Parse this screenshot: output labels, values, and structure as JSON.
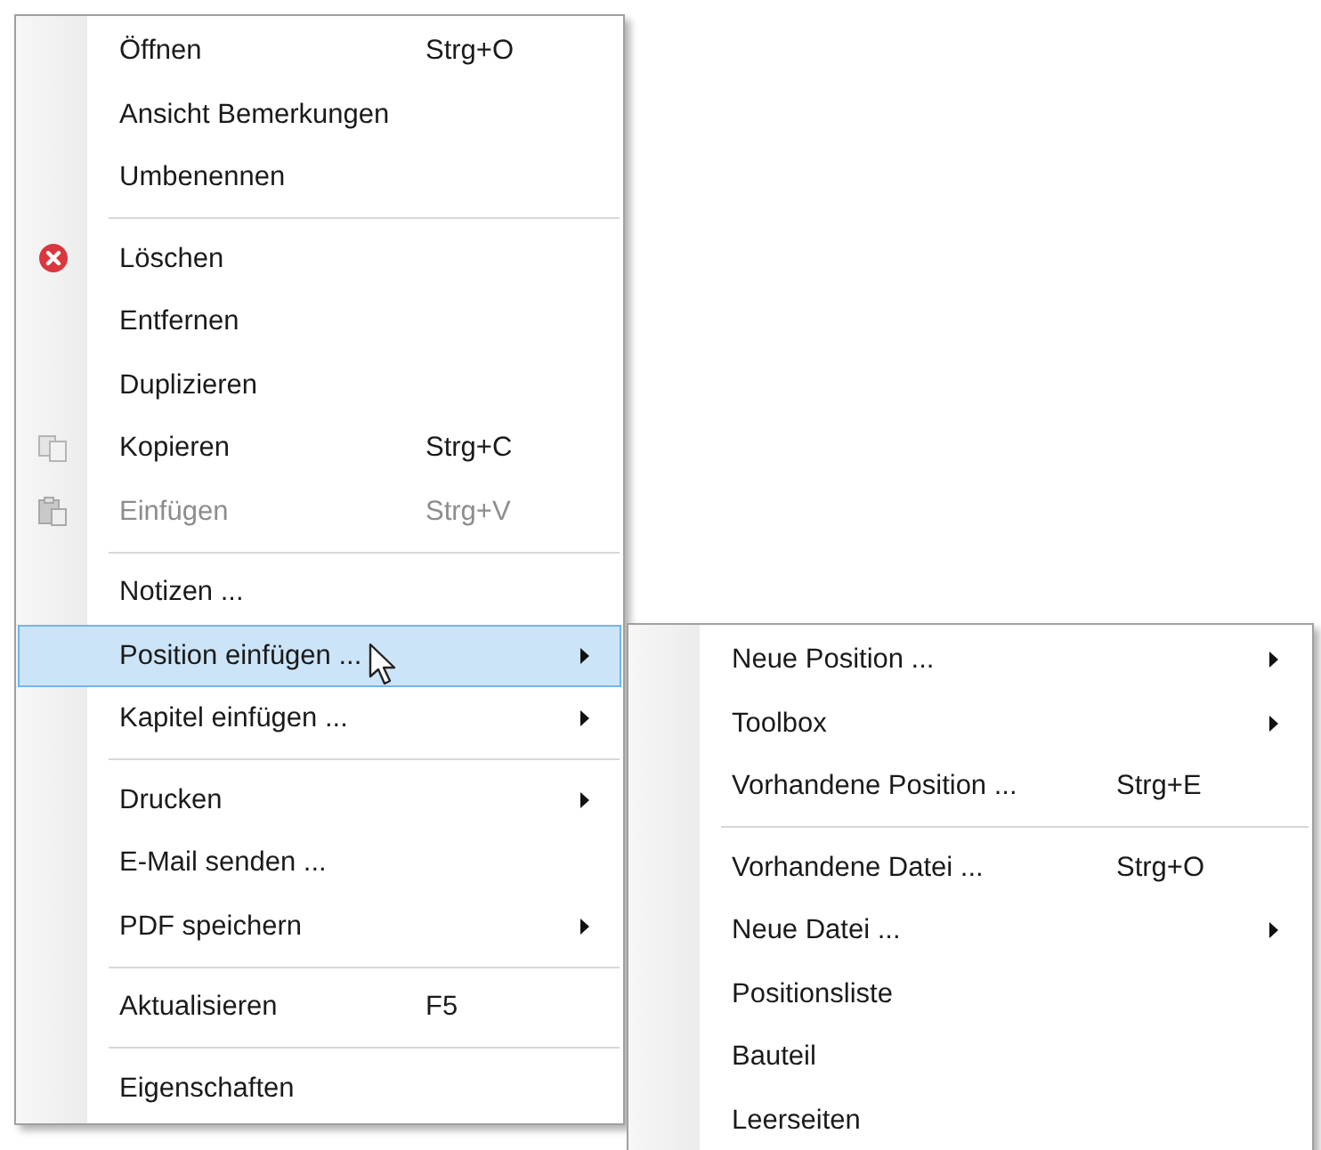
{
  "context_menu": {
    "items": [
      {
        "kind": "item",
        "label": "Öffnen",
        "shortcut": "Strg+O",
        "submenu": false,
        "disabled": false,
        "selected": false
      },
      {
        "kind": "item",
        "label": "Ansicht Bemerkungen",
        "submenu": false,
        "disabled": false,
        "selected": false
      },
      {
        "kind": "item",
        "label": "Umbenennen",
        "submenu": false,
        "disabled": false,
        "selected": false
      },
      {
        "kind": "separator"
      },
      {
        "kind": "delete",
        "label": "Löschen",
        "submenu": false,
        "disabled": false,
        "selected": false
      },
      {
        "kind": "item",
        "label": "Entfernen",
        "submenu": false,
        "disabled": false,
        "selected": false
      },
      {
        "kind": "item",
        "label": "Duplizieren",
        "submenu": false,
        "disabled": false,
        "selected": false
      },
      {
        "kind": "copy",
        "label": "Kopieren",
        "shortcut": "Strg+C",
        "submenu": false,
        "disabled": false,
        "selected": false
      },
      {
        "kind": "paste",
        "label": "Einfügen",
        "shortcut": "Strg+V",
        "submenu": false,
        "disabled": true,
        "selected": false
      },
      {
        "kind": "separator"
      },
      {
        "kind": "item",
        "label": "Notizen ...",
        "submenu": false,
        "disabled": false,
        "selected": false
      },
      {
        "kind": "item",
        "label": "Position einfügen ...",
        "submenu": true,
        "disabled": false,
        "selected": true
      },
      {
        "kind": "item",
        "label": "Kapitel einfügen ...",
        "submenu": true,
        "disabled": false,
        "selected": false
      },
      {
        "kind": "separator"
      },
      {
        "kind": "item",
        "label": "Drucken",
        "submenu": true,
        "disabled": false,
        "selected": false
      },
      {
        "kind": "item",
        "label": "E-Mail senden ...",
        "submenu": false,
        "disabled": false,
        "selected": false
      },
      {
        "kind": "item",
        "label": "PDF speichern",
        "submenu": true,
        "disabled": false,
        "selected": false
      },
      {
        "kind": "separator"
      },
      {
        "kind": "item",
        "label": "Aktualisieren",
        "shortcut": "F5",
        "submenu": false,
        "disabled": false,
        "selected": false
      },
      {
        "kind": "separator"
      },
      {
        "kind": "item",
        "label": "Eigenschaften",
        "submenu": false,
        "disabled": false,
        "selected": false
      }
    ]
  },
  "submenu": {
    "items": [
      {
        "kind": "item",
        "label": "Neue Position ...",
        "submenu": true,
        "disabled": false,
        "selected": false
      },
      {
        "kind": "item",
        "label": "Toolbox",
        "submenu": true,
        "disabled": false,
        "selected": false
      },
      {
        "kind": "item",
        "label": "Vorhandene Position ...",
        "shortcut": "Strg+E",
        "submenu": false,
        "disabled": false,
        "selected": false
      },
      {
        "kind": "separator"
      },
      {
        "kind": "item",
        "label": "Vorhandene Datei ...",
        "shortcut": "Strg+O",
        "submenu": false,
        "disabled": false,
        "selected": false
      },
      {
        "kind": "item",
        "label": "Neue Datei ...",
        "submenu": true,
        "disabled": false,
        "selected": false
      },
      {
        "kind": "item",
        "label": "Positionsliste",
        "submenu": false,
        "disabled": false,
        "selected": false
      },
      {
        "kind": "item",
        "label": "Bauteil",
        "submenu": false,
        "disabled": false,
        "selected": false
      },
      {
        "kind": "item",
        "label": "Leerseiten",
        "submenu": false,
        "disabled": false,
        "selected": false
      }
    ]
  }
}
